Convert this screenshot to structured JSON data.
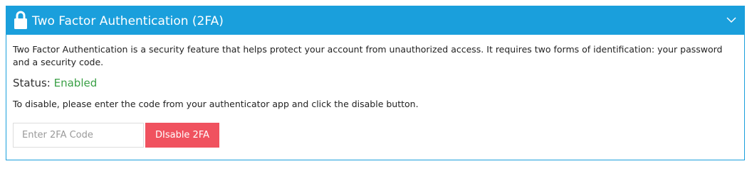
{
  "panel": {
    "title": "Two Factor Authentication (2FA)",
    "lock_icon": "lock-icon",
    "collapse_icon": "chevron-down-icon",
    "header_color": "#1a9fdc"
  },
  "body": {
    "description": "Two Factor Authentication is a security feature that helps protect your account from unauthorized access. It requires two forms of identification: your password and a security code.",
    "status_label": "Status: ",
    "status_value": "Enabled",
    "status_color": "#3aa046",
    "instructions": "To disable, please enter the code from your authenticator app and click the disable button."
  },
  "form": {
    "code_placeholder": "Enter 2FA Code",
    "code_value": "",
    "disable_label": "DIsable 2FA",
    "disable_color": "#f0525f"
  }
}
